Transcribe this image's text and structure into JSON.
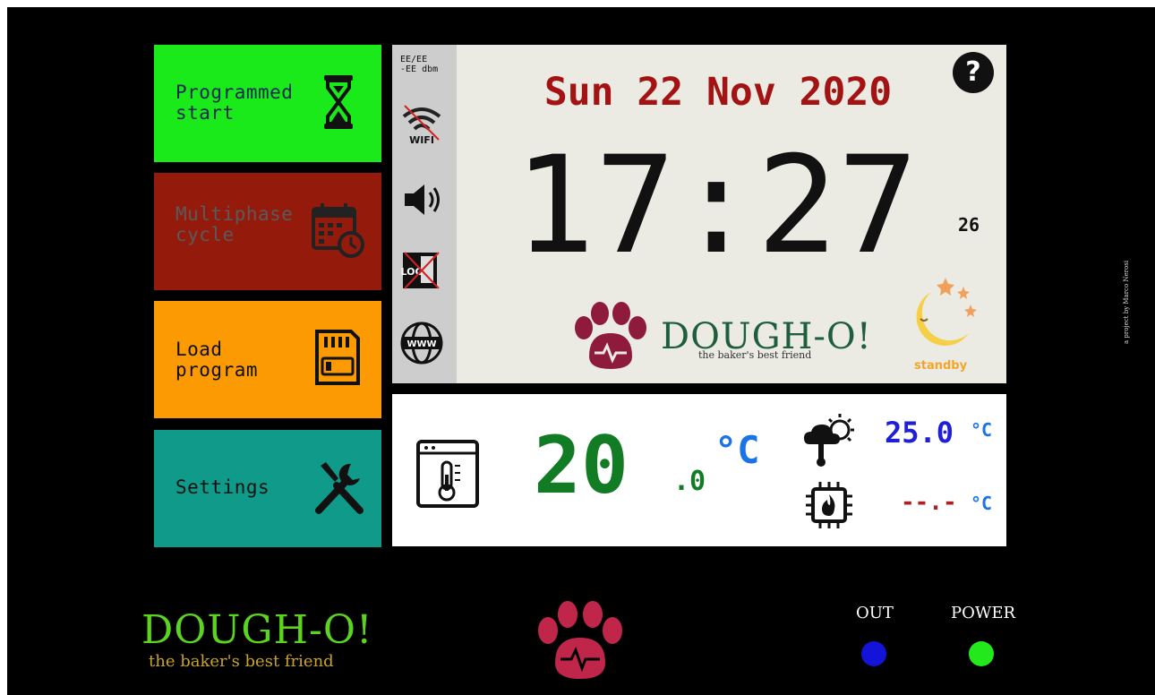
{
  "menu": {
    "programmed_start": "Programmed\nstart",
    "multiphase_cycle": "Multiphase\ncycle",
    "load_program": "Load\nprogram",
    "settings": "Settings"
  },
  "status": {
    "signal": "EE/EE\n-EE dbm",
    "wifi_label": "WIFI",
    "log_label": "LOG",
    "www_label": "WWW"
  },
  "clock": {
    "date": "Sun 22 Nov 2020",
    "time": "17:27",
    "seconds": "26",
    "help": "?"
  },
  "brand": {
    "name": "DOUGH-O!",
    "tagline": "the baker's best friend"
  },
  "state": {
    "standby_label": "standby"
  },
  "temperature": {
    "main_int": "20",
    "main_dec": ".0",
    "unit": "°C",
    "outdoor_value": "25.0",
    "outdoor_unit": "°C",
    "cpu_value": "--.-",
    "cpu_unit": "°C"
  },
  "leds": {
    "out_label": "OUT",
    "power_label": "POWER",
    "out_color": "#1414d8",
    "power_color": "#22e81c"
  },
  "credit": "a project by Marco Nerosi",
  "colors": {
    "programmed": "#1ae91a",
    "multiphase": "#941b0c",
    "load": "#fc9a04",
    "settings": "#109a8a",
    "paw": "#8e1a3c"
  }
}
